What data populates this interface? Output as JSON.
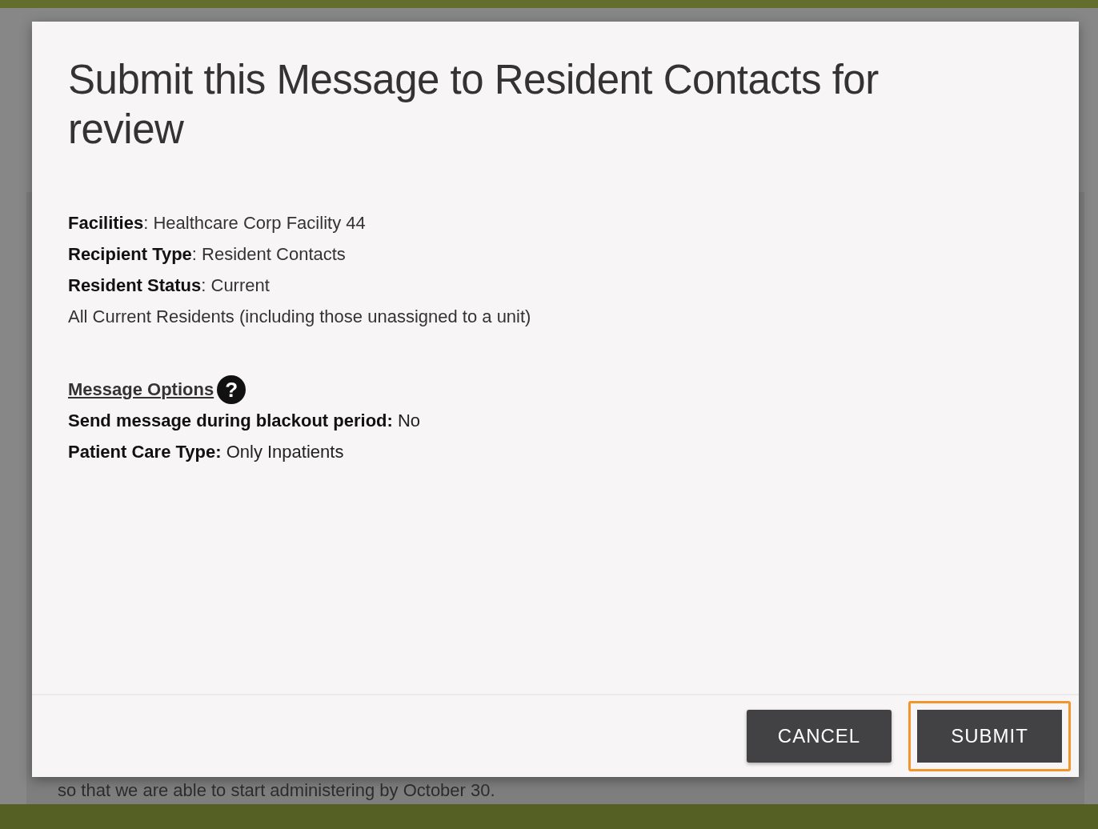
{
  "background_text": "so that we are able to start administering by October 30.",
  "dialog": {
    "title": "Submit this Message to Resident Contacts for review",
    "details": [
      "**Facilities**: Healthcare Corp Facility 44",
      "**Recipient Type**: Resident Contacts",
      "**Resident Status**: Current",
      "All Current Residents (including those unassigned to a unit)"
    ],
    "options_heading": "Message Options",
    "help_icon": "?",
    "options": [
      "**Send message during blackout period:** No",
      "**Patient Care Type:** Only Inpatients"
    ],
    "buttons": [
      {
        "label": "CANCEL",
        "focused": false
      },
      {
        "label": "SUBMIT",
        "focused": true
      }
    ]
  }
}
